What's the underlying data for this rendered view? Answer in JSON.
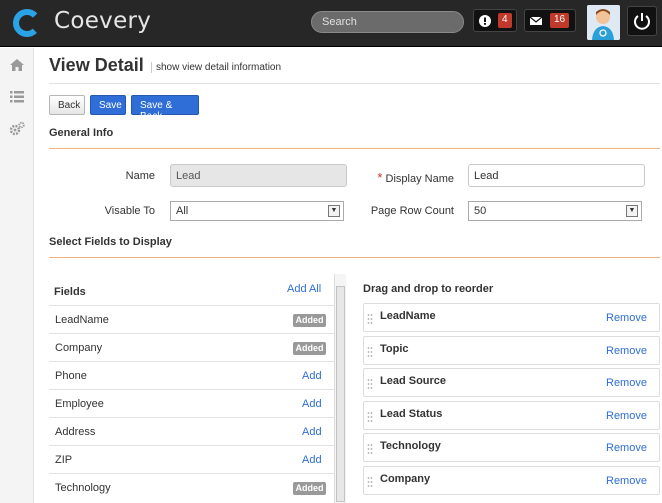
{
  "app": {
    "name": "Coevery"
  },
  "header": {
    "search_placeholder": "Search",
    "alerts_count": "4",
    "messages_count": "16"
  },
  "page": {
    "title": "View Detail",
    "subtitle": "show view detail information"
  },
  "toolbar": {
    "back_label": "Back",
    "save_label": "Save",
    "save_back_label": "Save & Back"
  },
  "general": {
    "heading": "General Info",
    "name_label": "Name",
    "name_value": "Lead",
    "display_name_required": "*",
    "display_name_label": "Display Name",
    "display_name_value": "Lead",
    "visible_label": "Visable To",
    "visible_value": "All",
    "page_row_label": "Page Row Count",
    "page_row_value": "50"
  },
  "fields": {
    "heading": "Select Fields to Display",
    "column_title": "Fields",
    "add_all_label": "Add All",
    "items": [
      {
        "name": "LeadName",
        "action": "Added"
      },
      {
        "name": "Company",
        "action": "Added"
      },
      {
        "name": "Phone",
        "action": "Add"
      },
      {
        "name": "Employee",
        "action": "Add"
      },
      {
        "name": "Address",
        "action": "Add"
      },
      {
        "name": "ZIP",
        "action": "Add"
      },
      {
        "name": "Technology",
        "action": "Added"
      }
    ]
  },
  "order": {
    "heading": "Drag and drop to reorder",
    "remove_label": "Remove",
    "items": [
      "LeadName",
      "Topic",
      "Lead Source",
      "Lead Status",
      "Technology",
      "Company"
    ]
  },
  "colors": {
    "accent": "#2e6ed6",
    "topbar": "#272727",
    "badge": "#c0392b",
    "section_line": "#f0b27a"
  },
  "icons": {
    "sidebar": [
      "home-icon",
      "list-icon",
      "gears-icon"
    ],
    "header": [
      "alert-icon",
      "mail-icon",
      "power-icon"
    ]
  }
}
